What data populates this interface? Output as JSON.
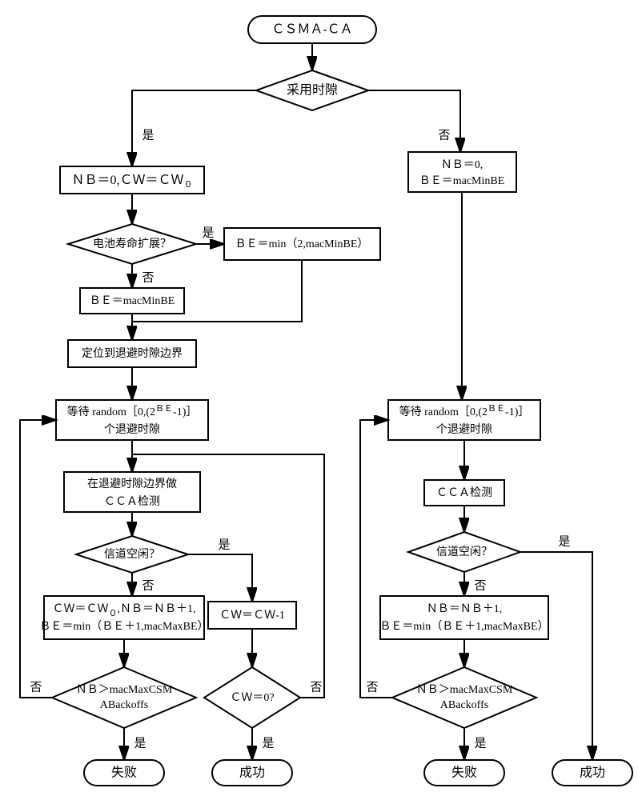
{
  "start": "ＣＳＭＡ-ＣＡ",
  "label_yes": "是",
  "label_no": "否",
  "dec_slot": "采用时隙",
  "left": {
    "init": "ＮＢ＝0,ＣＷ＝ＣＷ",
    "init_sub": "０",
    "dec_battery": "电池寿命扩展？",
    "be_min2": "ＢＥ＝min（2,macMinBE）",
    "be_macmin": "ＢＥ＝macMinBE",
    "locate": "定位到退避时隙边界",
    "wait_l1": "等待 random［0,(2",
    "wait_exp": "ＢＥ",
    "wait_l1_tail": "-1)］",
    "wait_l2": "个退避时隙",
    "cca_l1": "在退避时隙边界做",
    "cca_l2": "ＣＣＡ检测",
    "dec_idle": "信道空闲？",
    "update_l1a": "ＣＷ＝ＣＷ",
    "update_l1a_sub": "０",
    "update_l1b": ",ＮＢ＝ＮＢ＋1,",
    "update_l2": "ＢＥ＝min（ＢＥ＋1,macMaxBE）",
    "cw_dec": "ＣＷ＝ＣＷ-1",
    "dec_nb_l1": "ＮＢ＞macMaxCSM",
    "dec_nb_l2": "ABackoffs",
    "dec_cw0": "ＣＷ＝0?",
    "fail": "失败",
    "success": "成功"
  },
  "right": {
    "init_l1": "ＮＢ＝0,",
    "init_l2": "ＢＥ＝macMinBE",
    "wait_l1": "等待 random［0,(2",
    "wait_exp": "ＢＥ",
    "wait_l1_tail": "-1)］",
    "wait_l2": "个退避时隙",
    "cca": "ＣＣＡ检测",
    "dec_idle": "信道空闲？",
    "update_l1": "ＮＢ＝ＮＢ＋1,",
    "update_l2": "ＢＥ＝min（ＢＥ＋1,macMaxBE）",
    "dec_nb_l1": "ＮＢ＞macMaxCSM",
    "dec_nb_l2": "ABackoffs",
    "fail": "失败",
    "success": "成功"
  }
}
